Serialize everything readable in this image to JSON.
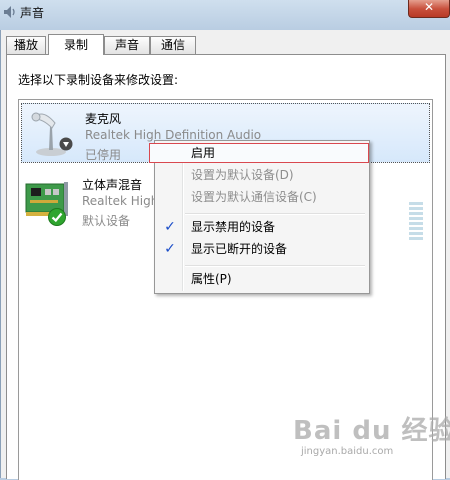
{
  "window": {
    "title": "声音",
    "close_glyph": "✕"
  },
  "tabs": [
    {
      "label": "播放",
      "active": false
    },
    {
      "label": "录制",
      "active": true
    },
    {
      "label": "声音",
      "active": false
    },
    {
      "label": "通信",
      "active": false
    }
  ],
  "instruction": "选择以下录制设备来修改设置:",
  "devices": [
    {
      "name": "麦克风",
      "description": "Realtek High Definition Audio",
      "status": "已停用",
      "icon": "microphone-icon",
      "badge": "disabled-arrow-icon",
      "selected": true
    },
    {
      "name": "立体声混音",
      "description": "Realtek High",
      "status": "默认设备",
      "icon": "sound-card-icon",
      "badge": "default-check-icon",
      "selected": false
    }
  ],
  "context_menu": {
    "items": [
      {
        "label": "启用",
        "enabled": true,
        "checked": false,
        "highlighted": true
      },
      {
        "label": "设置为默认设备(D)",
        "enabled": false,
        "checked": false
      },
      {
        "label": "设置为默认通信设备(C)",
        "enabled": false,
        "checked": false
      },
      {
        "label": "显示禁用的设备",
        "enabled": true,
        "checked": true
      },
      {
        "label": "显示已断开的设备",
        "enabled": true,
        "checked": true
      },
      {
        "label": "属性(P)",
        "enabled": true,
        "checked": false
      }
    ],
    "check_glyph": "✓"
  },
  "watermark": {
    "logo": "Bai du 经验",
    "url": "jingyan.baidu.com"
  },
  "colors": {
    "selection_bg": "#d6e8fb",
    "highlight_border": "#d9484f",
    "check": "#1a4dc8",
    "default_badge": "#2fa52f"
  }
}
